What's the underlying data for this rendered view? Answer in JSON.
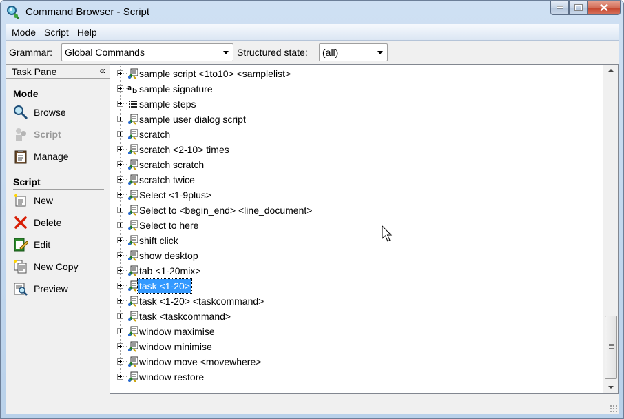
{
  "window": {
    "title": "Command Browser - Script"
  },
  "menu": [
    "Mode",
    "Script",
    "Help"
  ],
  "toolbar": {
    "grammar_label": "Grammar:",
    "grammar_value": "Global Commands",
    "state_label": "Structured state:",
    "state_value": "(all)"
  },
  "taskpane": {
    "title": "Task Pane",
    "collapse_glyph": "«",
    "mode_heading": "Mode",
    "mode_items": [
      {
        "label": "Browse",
        "icon": "magnifier-icon"
      },
      {
        "label": "Script",
        "icon": "script-puzzle-icon",
        "disabled": true
      },
      {
        "label": "Manage",
        "icon": "clipboard-icon"
      }
    ],
    "script_heading": "Script",
    "script_items": [
      {
        "label": "New",
        "icon": "new-script-icon"
      },
      {
        "label": "Delete",
        "icon": "delete-x-icon"
      },
      {
        "label": "Edit",
        "icon": "edit-icon"
      },
      {
        "label": "New Copy",
        "icon": "new-copy-icon"
      },
      {
        "label": "Preview",
        "icon": "preview-icon"
      }
    ]
  },
  "tree": {
    "selected_index": 14,
    "items": [
      {
        "label": "sample script <1to10> <samplelist>",
        "icon": "script"
      },
      {
        "label": "sample signature",
        "icon": "text-ab"
      },
      {
        "label": "sample steps",
        "icon": "list"
      },
      {
        "label": "sample user dialog script",
        "icon": "script"
      },
      {
        "label": "scratch",
        "icon": "script"
      },
      {
        "label": "scratch <2-10> times",
        "icon": "script"
      },
      {
        "label": "scratch scratch",
        "icon": "script"
      },
      {
        "label": "scratch twice",
        "icon": "script"
      },
      {
        "label": "Select <1-9plus>",
        "icon": "script"
      },
      {
        "label": "Select to <begin_end> <line_document>",
        "icon": "script"
      },
      {
        "label": "Select to here",
        "icon": "script"
      },
      {
        "label": "shift click",
        "icon": "script"
      },
      {
        "label": "show desktop",
        "icon": "script"
      },
      {
        "label": "tab <1-20mix>",
        "icon": "script"
      },
      {
        "label": "task <1-20>",
        "icon": "script"
      },
      {
        "label": "task <1-20> <taskcommand>",
        "icon": "script"
      },
      {
        "label": "task <taskcommand>",
        "icon": "script"
      },
      {
        "label": "window maximise",
        "icon": "script"
      },
      {
        "label": "window minimise",
        "icon": "script"
      },
      {
        "label": "window move <movewhere>",
        "icon": "script"
      },
      {
        "label": "window restore",
        "icon": "script"
      }
    ]
  },
  "colors": {
    "selection": "#3399ff",
    "frame": "#b9d1ea",
    "close": "#c3432a"
  }
}
